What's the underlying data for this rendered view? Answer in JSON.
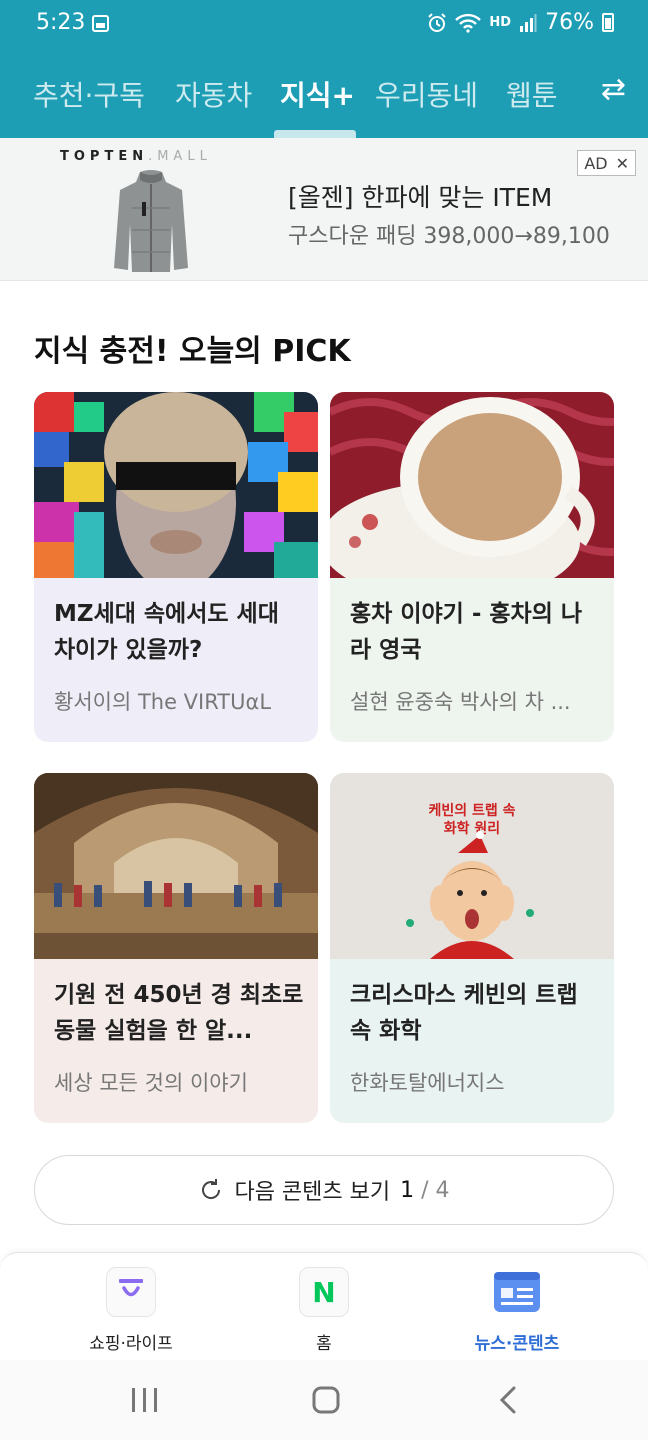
{
  "status": {
    "time": "5:23",
    "network": "HD",
    "battery": "76%"
  },
  "tabs": [
    {
      "label": "추천·구독",
      "active": false
    },
    {
      "label": "자동차",
      "active": false
    },
    {
      "label": "지식+",
      "active": true
    },
    {
      "label": "우리동네",
      "active": false
    },
    {
      "label": "웹툰",
      "active": false
    }
  ],
  "swap_icon": "⇄",
  "ad": {
    "brand": "TOPTEN",
    "brand_suffix": ".MALL",
    "title": "[올젠] 한파에 맞는 ITEM",
    "subtitle": "구스다운 패딩 398,000→89,100",
    "badge": "AD",
    "close": "✕"
  },
  "section": {
    "title": "지식 충전! 오늘의 PICK"
  },
  "cards": [
    {
      "title": "MZ세대 속에서도 세대 차이가 있을까?",
      "source": "황서이의 The VIRTUαL",
      "bg": "#efeef8"
    },
    {
      "title": "홍차 이야기 - 홍차의 나라 영국",
      "source": "설현 윤중숙 박사의 차 ...",
      "bg": "#eef4ee"
    },
    {
      "title": "기원 전 450년 경 최초로 동물 실험을 한 알...",
      "source": "세상 모든 것의 이야기",
      "bg": "#f5ece9"
    },
    {
      "title": "크리스마스 케빈의 트랩 속 화학",
      "source": "한화토탈에너지스",
      "bg": "#e9f3f1",
      "thumb_text_line1": "케빈의 트랩 속",
      "thumb_text_line2": "화학 원리"
    }
  ],
  "more": {
    "label": "다음 콘텐츠 보기",
    "page": "1",
    "total": "/ 4"
  },
  "bottom_nav": [
    {
      "label": "쇼핑·라이프",
      "icon": "shopping-bag-icon"
    },
    {
      "label": "홈",
      "icon": "naver-n-icon",
      "icon_text": "N"
    },
    {
      "label": "뉴스·콘텐츠",
      "icon": "news-icon",
      "active": true
    }
  ],
  "colors": {
    "header": "#1d9eb5",
    "active_nav": "#2f6ed6",
    "naver_green": "#03c75a"
  }
}
